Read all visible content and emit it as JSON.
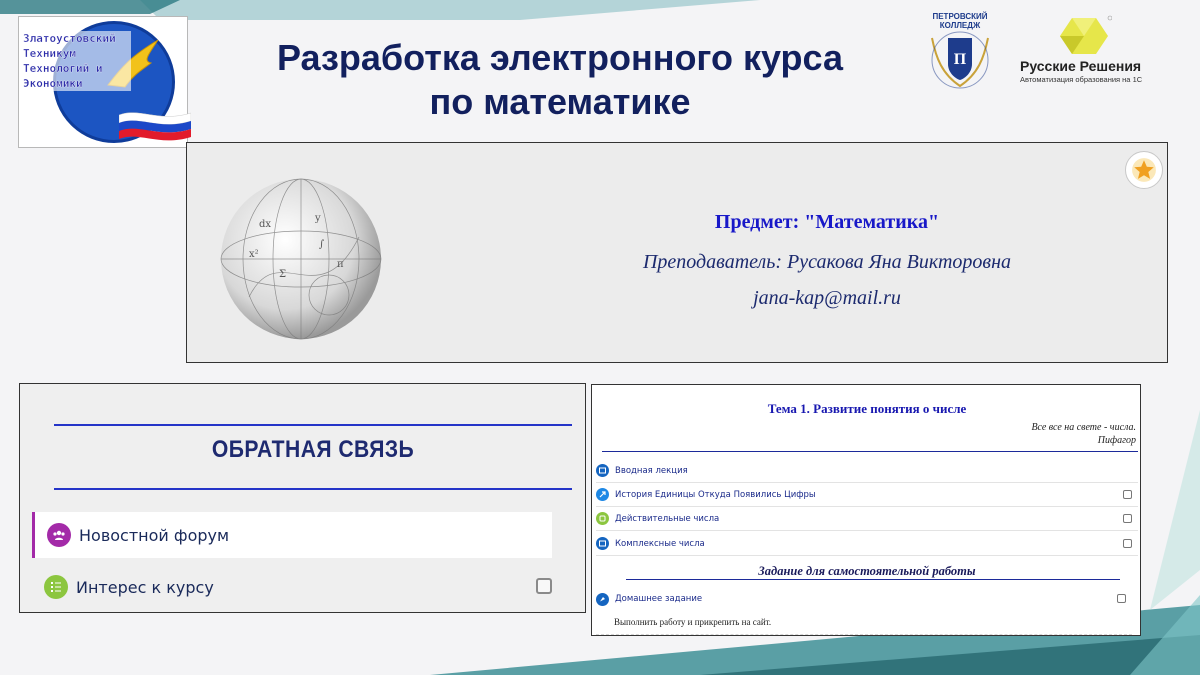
{
  "header": {
    "title_line1": "Разработка электронного курса",
    "title_line2": "по математике"
  },
  "logo": {
    "line1": "Златоустовский",
    "line2": "Техникум",
    "line3": "Технологий и",
    "line4": "Экономики"
  },
  "partners": {
    "petrov_line1": "ПЕТРОВСКИЙ",
    "petrov_line2": "КОЛЛЕДЖ",
    "rr_name": "Русские Решения",
    "rr_sub": "Автоматизация образования на 1С"
  },
  "course": {
    "subject": "Предмет: \"Математика\"",
    "teacher": "Преподаватель: Русакова Яна Викторовна",
    "email": "jana-kap@mail.ru"
  },
  "feedback": {
    "heading": "ОБРАТНАЯ СВЯЗЬ",
    "items": [
      {
        "label": "Новостной форум"
      },
      {
        "label": "Интерес к курсу"
      }
    ]
  },
  "topic": {
    "title": "Тема 1. Развитие понятия о числе",
    "epigraph_line1": "Все все на свете - числа.",
    "epigraph_line2": "Пифагор",
    "items": [
      {
        "label": "Вводная лекция"
      },
      {
        "label": "История Единицы Откуда Появились Цифры"
      },
      {
        "label": "Действительные числа"
      },
      {
        "label": "Комплексные числа"
      }
    ],
    "section_title": "Задание для самостоятельной работы",
    "homework": {
      "label": "Домашнее задание",
      "description": "Выполнить работу и прикрепить на сайт."
    }
  },
  "colors": {
    "title": "#12205e",
    "accent_blue": "#1818c8",
    "forum_purple": "#a32aa8",
    "green": "#8cc63f"
  }
}
